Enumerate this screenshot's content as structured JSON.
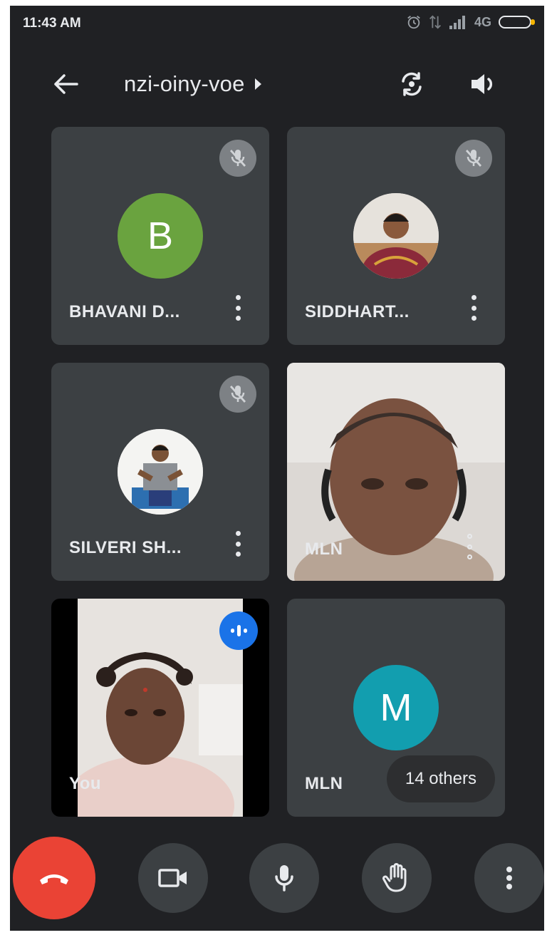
{
  "status_bar": {
    "time": "11:43 AM",
    "network_label": "4G"
  },
  "header": {
    "meeting_code": "nzi-oiny-voe",
    "icons": [
      "back-arrow-icon",
      "caret-right-icon",
      "switch-camera-icon",
      "speaker-icon"
    ]
  },
  "tiles": [
    {
      "name": "BHAVANI D...",
      "avatar_letter": "B",
      "avatar_color": "#6aa33f",
      "muted": true
    },
    {
      "name": "SIDDHART...",
      "avatar_type": "photo",
      "muted": true
    },
    {
      "name": "SILVERI SH...",
      "avatar_type": "photo",
      "muted": true
    },
    {
      "name": "MLN",
      "type": "video"
    },
    {
      "name": "You",
      "type": "video",
      "speaking": true
    },
    {
      "name": "MLN",
      "avatar_letter": "M",
      "avatar_color": "#129eaf",
      "others_label": "14 others"
    }
  ],
  "controls": {
    "icons": [
      "end-call-icon",
      "camera-icon",
      "microphone-icon",
      "raise-hand-icon",
      "more-options-icon"
    ],
    "end_call_color": "#ea4335"
  },
  "colors": {
    "background": "#202124",
    "tile": "#3c4043",
    "accent_blue": "#1a73e8"
  }
}
